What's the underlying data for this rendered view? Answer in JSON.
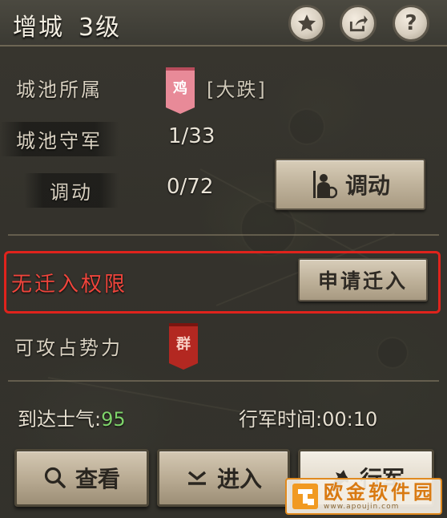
{
  "header": {
    "title": "增城",
    "level": "3级",
    "icons": [
      "star-icon",
      "share-icon",
      "help-icon"
    ],
    "help_glyph": "?"
  },
  "info": {
    "owner_label": "城池所属",
    "owner_flag": "鸡",
    "owner_name": "[大跌]",
    "garrison_label": "城池守军",
    "garrison_value": "1/33",
    "transfer_label": "调动",
    "transfer_value": "0/72",
    "transfer_button": "调动"
  },
  "migration": {
    "status": "无迁入权限",
    "apply_button": "申请迁入"
  },
  "attack": {
    "label": "可攻占势力",
    "flag": "群"
  },
  "stats": {
    "morale_label": "到达士气:",
    "morale_value": "95",
    "march_label": "行军时间:",
    "march_value": "00:10"
  },
  "actions": {
    "view": "查看",
    "enter": "进入",
    "march": "行军"
  },
  "watermark": {
    "main": "欧金软件园",
    "url": "www.apoujin.com"
  },
  "colors": {
    "highlight": "#e0231c",
    "no_permission_text": "#f0453c",
    "morale_value": "#7ed36a",
    "owner_flag": "#e88a98",
    "attack_flag": "#b32821"
  }
}
